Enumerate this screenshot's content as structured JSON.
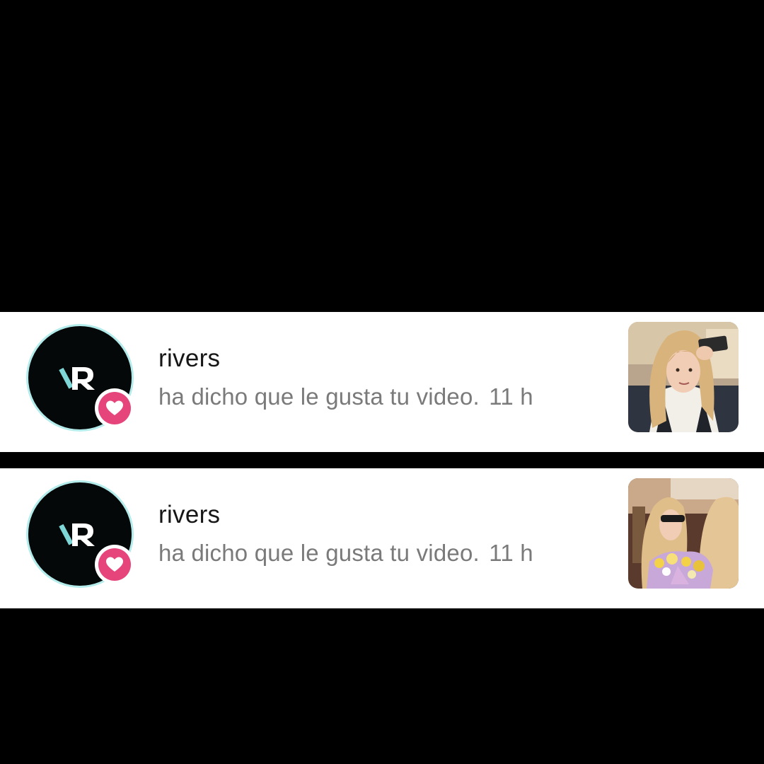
{
  "notifications": [
    {
      "username": "rivers",
      "message": "ha dicho que le gusta tu video.",
      "time": "11 h",
      "avatar_icon": "rivers-logo-avatar",
      "badge_icon": "heart-icon",
      "badge_color": "#e6457c",
      "thumbnail": "video-thumbnail-woman-selfie"
    },
    {
      "username": "rivers",
      "message": "ha dicho que le gusta tu video.",
      "time": "11 h",
      "avatar_icon": "rivers-logo-avatar",
      "badge_icon": "heart-icon",
      "badge_color": "#e6457c",
      "thumbnail": "video-thumbnail-two-women-flowers"
    }
  ]
}
